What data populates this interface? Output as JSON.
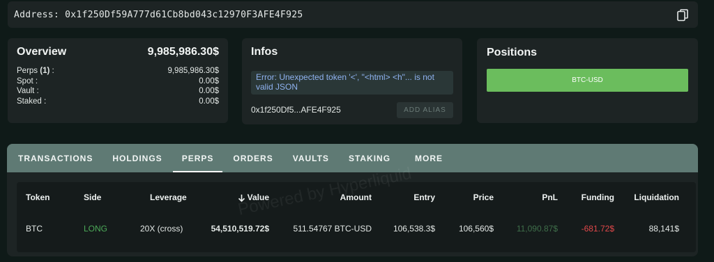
{
  "address_bar": {
    "label": "Address: 0x1f250Df59A777d61Cb8bd043c12970F3AFE4F925",
    "copy_icon": "copy-icon"
  },
  "overview": {
    "title": "Overview",
    "total": "9,985,986.30$",
    "rows": [
      {
        "label_prefix": "Perps ",
        "label_count": "(1)",
        "label_suffix": " :",
        "value": "9,985,986.30$"
      },
      {
        "label": "Spot :",
        "value": "0.00$"
      },
      {
        "label": "Vault :",
        "value": "0.00$"
      },
      {
        "label": "Staked :",
        "value": "0.00$"
      }
    ]
  },
  "infos": {
    "title": "Infos",
    "error": "Error: Unexpected token '<', \"<html> <h\"... is not valid JSON",
    "short_address": "0x1f250Df5...AFE4F925",
    "add_alias_label": "ADD ALIAS"
  },
  "positions": {
    "title": "Positions",
    "button_label": "BTC-USD",
    "button_color": "#6bbd5d"
  },
  "tabs": [
    {
      "label": "TRANSACTIONS",
      "active": false
    },
    {
      "label": "HOLDINGS",
      "active": false
    },
    {
      "label": "PERPS",
      "active": true
    },
    {
      "label": "ORDERS",
      "active": false
    },
    {
      "label": "VAULTS",
      "active": false
    },
    {
      "label": "STAKING",
      "active": false
    },
    {
      "label": "MORE",
      "active": false
    }
  ],
  "table": {
    "headers": {
      "token": "Token",
      "side": "Side",
      "leverage": "Leverage",
      "value": "Value",
      "amount": "Amount",
      "entry": "Entry",
      "price": "Price",
      "pnl": "PnL",
      "funding": "Funding",
      "liquidation": "Liquidation"
    },
    "sort_icon": "arrow-down-icon",
    "rows": [
      {
        "token": "BTC",
        "side": "LONG",
        "leverage": "20X (cross)",
        "value": "54,510,519.72$",
        "amount": "511.54767 BTC-USD",
        "entry": "106,538.3$",
        "price": "106,560$",
        "pnl": "11,090.87$",
        "funding": "-681.72$",
        "liquidation": "88,141$"
      }
    ]
  },
  "watermark": "Powered by Hyperliquid",
  "colors": {
    "background": "#0f1a18",
    "card": "#1d2424",
    "tabbar": "#5f7a74",
    "long": "#4caa58",
    "pnl_positive": "#3f6f4a",
    "funding_negative": "#e0484a",
    "error_text": "#8fb2f0"
  }
}
